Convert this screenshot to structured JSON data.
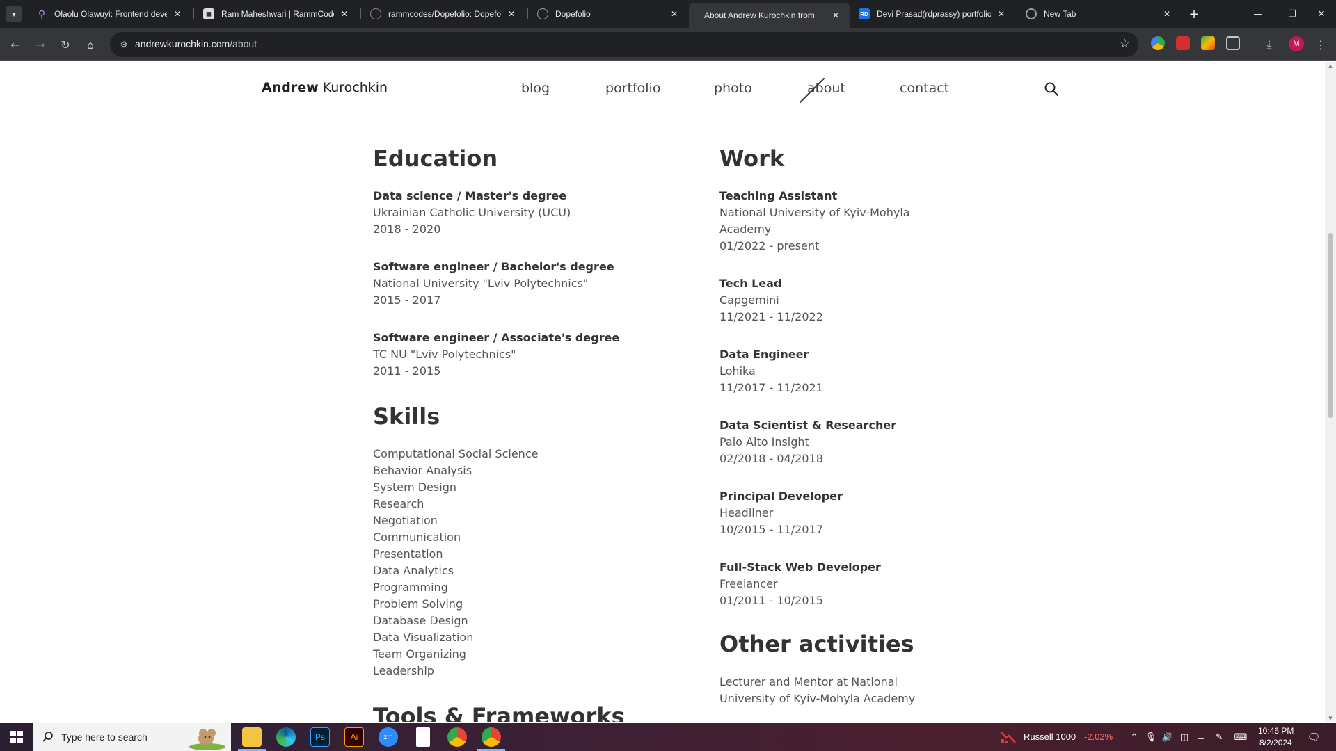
{
  "browser": {
    "tabs": [
      {
        "title": "Olaolu Olawuyi: Frontend deve",
        "favicon": "pin-icon"
      },
      {
        "title": "Ram Maheshwari | RammCode",
        "favicon": "person-icon"
      },
      {
        "title": "rammcodes/Dopefolio: Dopefo",
        "favicon": "github-icon"
      },
      {
        "title": "Dopefolio",
        "favicon": "globe-icon"
      },
      {
        "title": "About Andrew Kurochkin from",
        "favicon": "none"
      },
      {
        "title": "Devi Prasad(rdprassy) portfolio",
        "favicon": "rd-icon"
      },
      {
        "title": "New Tab",
        "favicon": "chrome-icon"
      }
    ],
    "url_host": "andrewkurochkin.com",
    "url_path": "/about",
    "profile_initial": "M"
  },
  "site": {
    "brand_first": "Andrew",
    "brand_last": "Kurochkin",
    "nav": [
      "blog",
      "portfolio",
      "photo",
      "about",
      "contact"
    ]
  },
  "education": {
    "heading": "Education",
    "items": [
      {
        "title": "Data science / Master's degree",
        "org": "Ukrainian Catholic University (UCU)",
        "dates": "2018 - 2020"
      },
      {
        "title": "Software engineer / Bachelor's degree",
        "org": "National University \"Lviv Polytechnics\"",
        "dates": "2015 - 2017"
      },
      {
        "title": "Software engineer / Associate's degree",
        "org": "TC NU \"Lviv Polytechnics\"",
        "dates": "2011 - 2015"
      }
    ]
  },
  "skills": {
    "heading": "Skills",
    "items": [
      "Computational Social Science",
      "Behavior Analysis",
      "System Design",
      "Research",
      "Negotiation",
      "Communication",
      "Presentation",
      "Data Analytics",
      "Programming",
      "Problem Solving",
      "Database Design",
      "Data Visualization",
      "Team Organizing",
      "Leadership"
    ]
  },
  "tools": {
    "heading": "Tools & Frameworks"
  },
  "work": {
    "heading": "Work",
    "items": [
      {
        "title": "Teaching Assistant",
        "org_line1": "National University of Kyiv-Mohyla",
        "org_line2": "Academy",
        "dates": "01/2022 - present"
      },
      {
        "title": "Tech Lead",
        "org_line1": "Capgemini",
        "dates": "11/2021 - 11/2022"
      },
      {
        "title": "Data Engineer",
        "org_line1": "Lohika",
        "dates": "11/2017 - 11/2021"
      },
      {
        "title": "Data Scientist & Researcher",
        "org_line1": "Palo Alto Insight",
        "dates": "02/2018 - 04/2018"
      },
      {
        "title": "Principal Developer",
        "org_line1": "Headliner",
        "dates": "10/2015 - 11/2017"
      },
      {
        "title": "Full-Stack Web Developer",
        "org_line1": "Freelancer",
        "dates": "01/2011 - 10/2015"
      }
    ]
  },
  "other": {
    "heading": "Other activities",
    "line1": "Lecturer and Mentor at National",
    "line2": "University of Kyiv-Mohyla Academy"
  },
  "taskbar": {
    "search_placeholder": "Type here to search",
    "ticker_name": "Russell 1000",
    "ticker_change": "-2.02%",
    "time": "10:46 PM",
    "date": "8/2/2024",
    "apps": [
      "file-explorer-icon",
      "edge-icon",
      "photoshop-icon",
      "illustrator-icon",
      "zoom-icon",
      "file-icon",
      "chrome-icon",
      "chrome-profile-icon"
    ]
  },
  "colors": {
    "accent": "#8ab4f8",
    "negative": "#ff6b6b"
  }
}
